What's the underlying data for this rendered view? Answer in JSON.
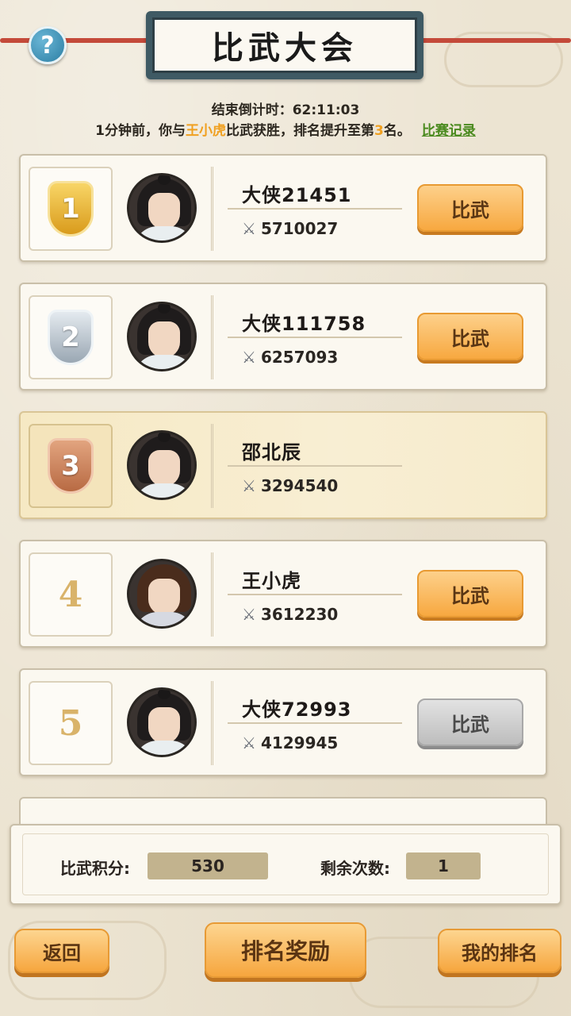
{
  "header": {
    "title": "比武大会",
    "help_symbol": "?"
  },
  "info": {
    "countdown_label": "结束倒计时：",
    "countdown_value": "62:11:03",
    "notice_prefix": "1分钟前，你与",
    "notice_opponent": "王小虎",
    "notice_middle": "比武获胜，排名提升至第",
    "notice_rank": "3",
    "notice_suffix": "名。",
    "record_link": "比赛记录"
  },
  "rankings": [
    {
      "rank": "1",
      "name": "大侠21451",
      "power": "5710027",
      "button": "比武"
    },
    {
      "rank": "2",
      "name": "大侠111758",
      "power": "6257093",
      "button": "比武"
    },
    {
      "rank": "3",
      "name": "邵北辰",
      "power": "3294540"
    },
    {
      "rank": "4",
      "name": "王小虎",
      "power": "3612230",
      "button": "比武"
    },
    {
      "rank": "5",
      "name": "大侠72993",
      "power": "4129945",
      "button": "比武"
    }
  ],
  "stats": {
    "score_label": "比武积分:",
    "score_value": "530",
    "remaining_label": "剩余次数:",
    "remaining_value": "1"
  },
  "buttons": {
    "back": "返回",
    "rank_reward": "排名奖励",
    "my_rank": "我的排名"
  },
  "colors": {
    "accent_orange": "#f7a840",
    "highlight_text": "#f0a020",
    "link_green": "#4a8a1e",
    "title_frame": "#3f5a64"
  },
  "icons": {
    "help": "question-mark-icon",
    "power": "crossed-swords-icon"
  }
}
